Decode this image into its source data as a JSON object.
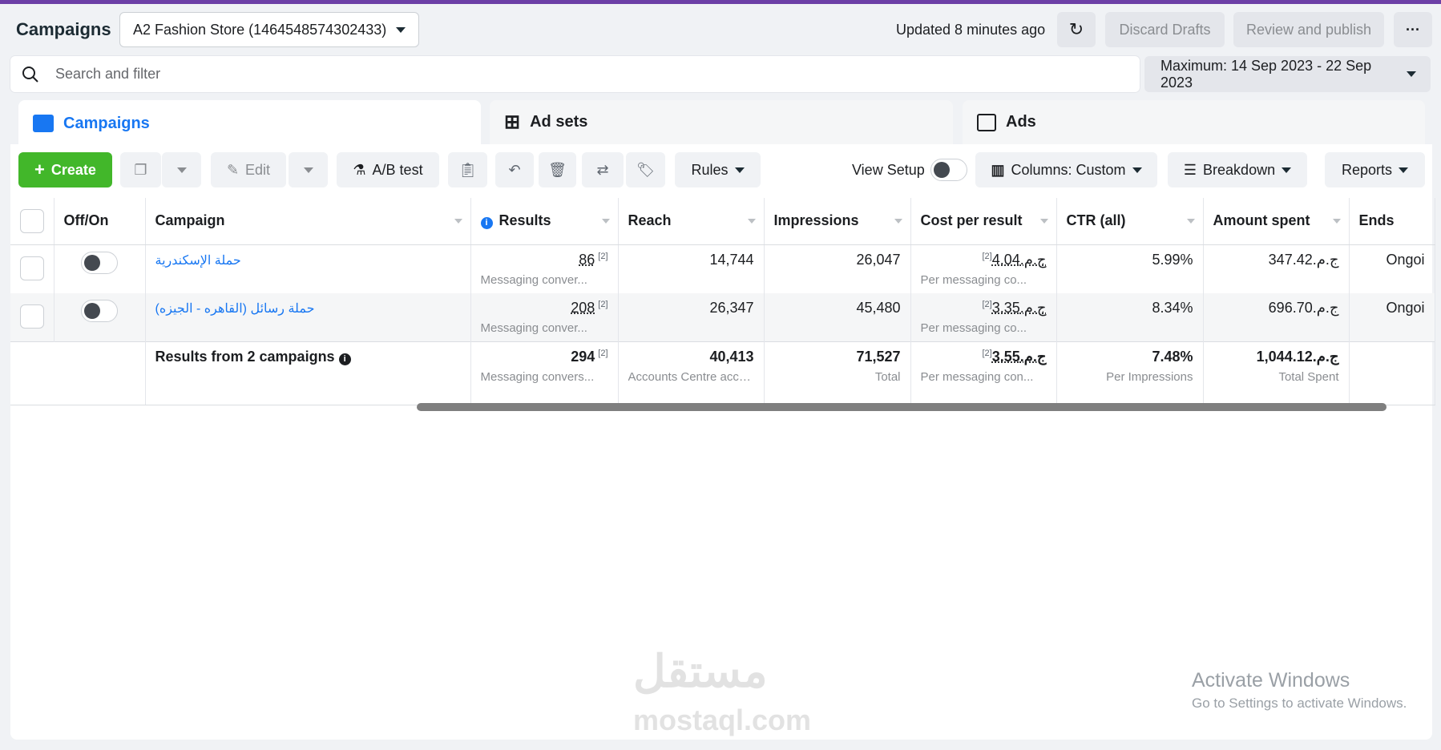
{
  "header": {
    "title": "Campaigns",
    "account": "A2 Fashion Store (1464548574302433)",
    "updated": "Updated 8 minutes ago",
    "discard": "Discard Drafts",
    "review": "Review and publish",
    "more": "···"
  },
  "search": {
    "placeholder": "Search and filter",
    "date": "Maximum: 14 Sep 2023 - 22 Sep 2023"
  },
  "tabs": [
    {
      "label": "Campaigns"
    },
    {
      "label": "Ad sets"
    },
    {
      "label": "Ads"
    }
  ],
  "toolbar": {
    "create": "Create",
    "edit": "Edit",
    "ab": "A/B test",
    "rules": "Rules",
    "view_setup": "View Setup",
    "columns": "Columns: Custom",
    "breakdown": "Breakdown",
    "reports": "Reports"
  },
  "columns": [
    "Off/On",
    "Campaign",
    "Results",
    "Reach",
    "Impressions",
    "Cost per result",
    "CTR (all)",
    "Amount spent",
    "Ends"
  ],
  "rows": [
    {
      "name": "حملة الإسكندرية",
      "results": "86",
      "results_sub": "Messaging conver...",
      "reach": "14,744",
      "impressions": "26,047",
      "cost": "ج.م.4.04",
      "cost_sub": "Per messaging co...",
      "ctr": "5.99%",
      "spent": "ج.م.347.42",
      "ends": "Ongoi"
    },
    {
      "name": "حملة رسائل (القاهره - الجيزه)",
      "results": "208",
      "results_sub": "Messaging conver...",
      "reach": "26,347",
      "impressions": "45,480",
      "cost": "ج.م.3.35",
      "cost_sub": "Per messaging co...",
      "ctr": "8.34%",
      "spent": "ج.م.696.70",
      "ends": "Ongoi"
    }
  ],
  "totals": {
    "label": "Results from 2 campaigns",
    "results": "294",
    "results_sub": "Messaging convers...",
    "reach": "40,413",
    "reach_sub": "Accounts Centre acco...",
    "impressions": "71,527",
    "impressions_sub": "Total",
    "cost": "ج.م.3.55",
    "cost_sub": "Per messaging con...",
    "ctr": "7.48%",
    "ctr_sub": "Per Impressions",
    "spent": "ج.م.1,044.12",
    "spent_sub": "Total Spent"
  },
  "footnote": "[2]",
  "watermark": {
    "logo": "مستقل",
    "site": "mostaql.com"
  },
  "windows": {
    "title": "Activate Windows",
    "sub": "Go to Settings to activate Windows."
  }
}
